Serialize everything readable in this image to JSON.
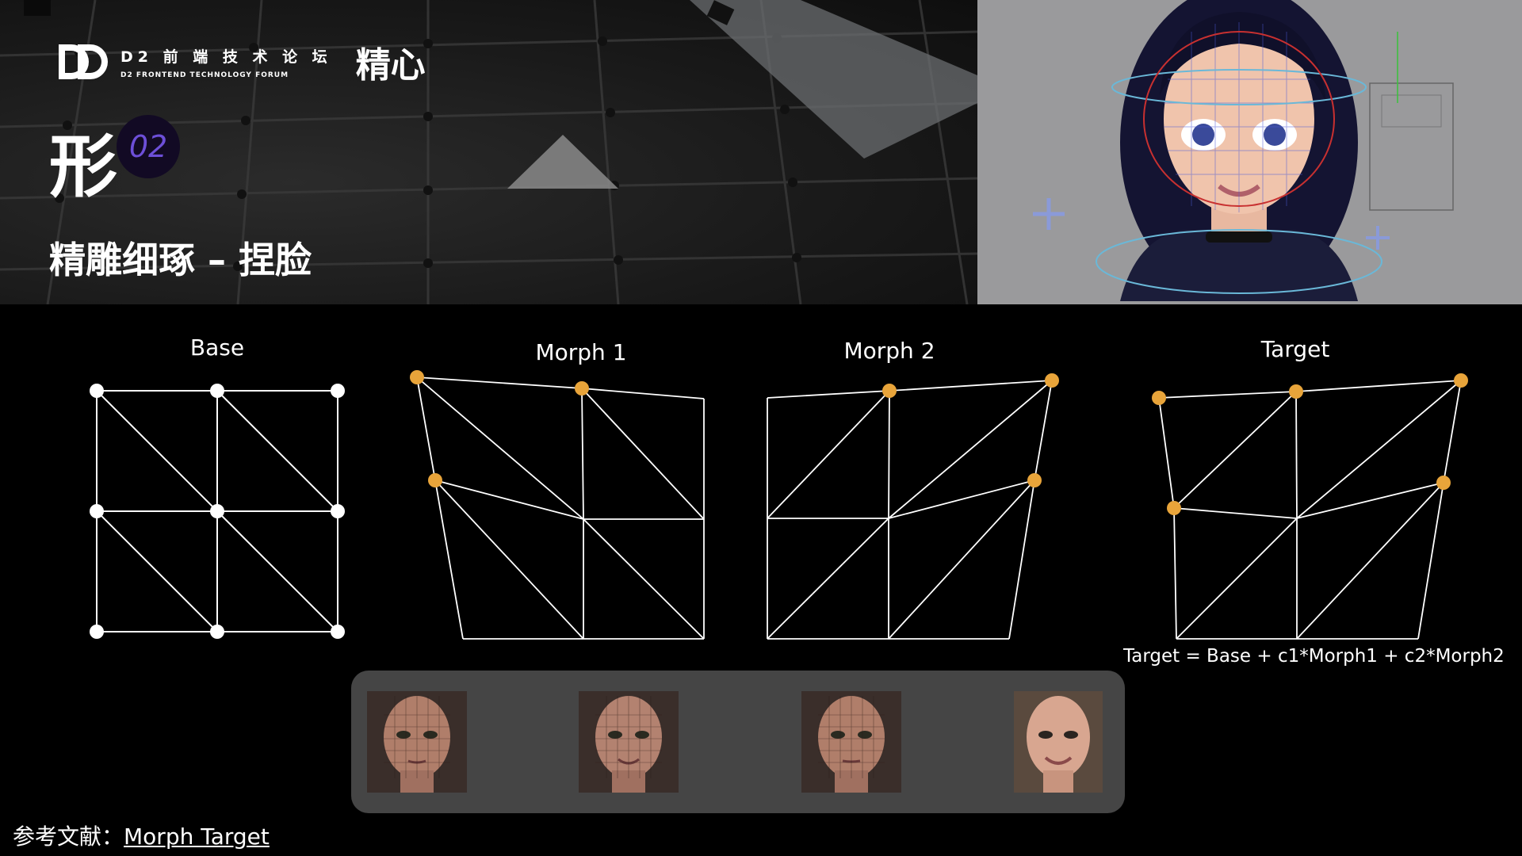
{
  "header": {
    "logo_title": "D2 前 端 技 术 论 坛",
    "logo_subtitle": "D2 FRONTEND TECHNOLOGY FORUM",
    "logo_secondary": "精心",
    "chapter_char": "形",
    "chapter_number": "02",
    "subtitle": "精雕细琢 – 捏脸"
  },
  "diagrams": [
    {
      "title": "Base"
    },
    {
      "title": "Morph 1"
    },
    {
      "title": "Morph 2"
    },
    {
      "title": "Target"
    }
  ],
  "formula": "Target = Base + c1*Morph1 + c2*Morph2",
  "reference": {
    "label": "参考文献：",
    "link_text": "Morph Target"
  },
  "colors": {
    "accent": "#e8a43a",
    "badge_bg": "#120a24",
    "badge_text": "#6d4fd8",
    "strip_bg": "#454545",
    "preview_bg": "#9a9a9c"
  }
}
